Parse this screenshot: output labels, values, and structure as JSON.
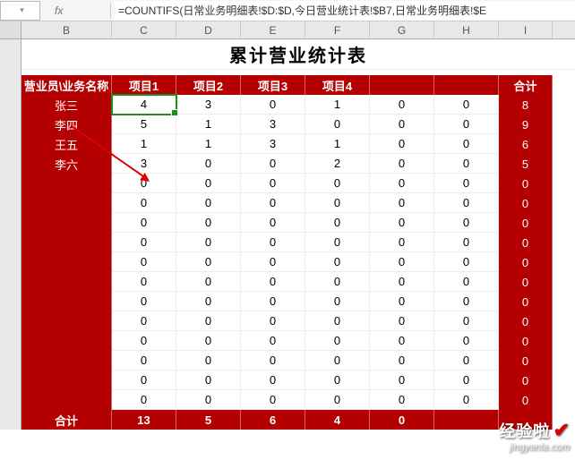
{
  "formula_bar": {
    "name_box": "",
    "fx": "fx",
    "formula": "=COUNTIFS(日常业务明细表!$D:$D,今日营业统计表!$B7,日常业务明细表!$E"
  },
  "col_headers": [
    "B",
    "C",
    "D",
    "E",
    "F",
    "G",
    "H",
    "I"
  ],
  "title": "累计营业统计表",
  "table_headers": {
    "name_col": "营业员\\业务名称",
    "items": [
      "项目1",
      "项目2",
      "项目3",
      "项目4"
    ],
    "total": "合计"
  },
  "rows": [
    {
      "name": "张三",
      "values": [
        4,
        3,
        0,
        1,
        0,
        0
      ],
      "total": 8
    },
    {
      "name": "李四",
      "values": [
        5,
        1,
        3,
        0,
        0,
        0
      ],
      "total": 9
    },
    {
      "name": "王五",
      "values": [
        1,
        1,
        3,
        1,
        0,
        0
      ],
      "total": 6
    },
    {
      "name": "李六",
      "values": [
        3,
        0,
        0,
        2,
        0,
        0
      ],
      "total": 5
    },
    {
      "name": "",
      "values": [
        0,
        0,
        0,
        0,
        0,
        0
      ],
      "total": 0
    },
    {
      "name": "",
      "values": [
        0,
        0,
        0,
        0,
        0,
        0
      ],
      "total": 0
    },
    {
      "name": "",
      "values": [
        0,
        0,
        0,
        0,
        0,
        0
      ],
      "total": 0
    },
    {
      "name": "",
      "values": [
        0,
        0,
        0,
        0,
        0,
        0
      ],
      "total": 0
    },
    {
      "name": "",
      "values": [
        0,
        0,
        0,
        0,
        0,
        0
      ],
      "total": 0
    },
    {
      "name": "",
      "values": [
        0,
        0,
        0,
        0,
        0,
        0
      ],
      "total": 0
    },
    {
      "name": "",
      "values": [
        0,
        0,
        0,
        0,
        0,
        0
      ],
      "total": 0
    },
    {
      "name": "",
      "values": [
        0,
        0,
        0,
        0,
        0,
        0
      ],
      "total": 0
    },
    {
      "name": "",
      "values": [
        0,
        0,
        0,
        0,
        0,
        0
      ],
      "total": 0
    },
    {
      "name": "",
      "values": [
        0,
        0,
        0,
        0,
        0,
        0
      ],
      "total": 0
    },
    {
      "name": "",
      "values": [
        0,
        0,
        0,
        0,
        0,
        0
      ],
      "total": 0
    },
    {
      "name": "",
      "values": [
        0,
        0,
        0,
        0,
        0,
        0
      ],
      "total": 0
    }
  ],
  "totals_row": {
    "label": "合计",
    "values": [
      13,
      5,
      6,
      4,
      0,
      ""
    ],
    "total": ""
  },
  "selected_cell": {
    "row": 0,
    "col": 0
  },
  "watermark": {
    "line1": "经验啦",
    "line2": "jingyanla.com"
  },
  "chart_data": {
    "type": "table",
    "title": "累计营业统计表",
    "row_header_label": "营业员\\业务名称",
    "columns": [
      "项目1",
      "项目2",
      "项目3",
      "项目4",
      "",
      "",
      "合计"
    ],
    "rows": [
      {
        "label": "张三",
        "cells": [
          4,
          3,
          0,
          1,
          0,
          0,
          8
        ]
      },
      {
        "label": "李四",
        "cells": [
          5,
          1,
          3,
          0,
          0,
          0,
          9
        ]
      },
      {
        "label": "王五",
        "cells": [
          1,
          1,
          3,
          1,
          0,
          0,
          6
        ]
      },
      {
        "label": "李六",
        "cells": [
          3,
          0,
          0,
          2,
          0,
          0,
          5
        ]
      },
      {
        "label": "",
        "cells": [
          0,
          0,
          0,
          0,
          0,
          0,
          0
        ]
      },
      {
        "label": "",
        "cells": [
          0,
          0,
          0,
          0,
          0,
          0,
          0
        ]
      },
      {
        "label": "",
        "cells": [
          0,
          0,
          0,
          0,
          0,
          0,
          0
        ]
      },
      {
        "label": "",
        "cells": [
          0,
          0,
          0,
          0,
          0,
          0,
          0
        ]
      },
      {
        "label": "",
        "cells": [
          0,
          0,
          0,
          0,
          0,
          0,
          0
        ]
      },
      {
        "label": "",
        "cells": [
          0,
          0,
          0,
          0,
          0,
          0,
          0
        ]
      },
      {
        "label": "",
        "cells": [
          0,
          0,
          0,
          0,
          0,
          0,
          0
        ]
      },
      {
        "label": "",
        "cells": [
          0,
          0,
          0,
          0,
          0,
          0,
          0
        ]
      },
      {
        "label": "",
        "cells": [
          0,
          0,
          0,
          0,
          0,
          0,
          0
        ]
      },
      {
        "label": "",
        "cells": [
          0,
          0,
          0,
          0,
          0,
          0,
          0
        ]
      },
      {
        "label": "",
        "cells": [
          0,
          0,
          0,
          0,
          0,
          0,
          0
        ]
      },
      {
        "label": "",
        "cells": [
          0,
          0,
          0,
          0,
          0,
          0,
          0
        ]
      }
    ],
    "totals": {
      "label": "合计",
      "cells": [
        13,
        5,
        6,
        4,
        0,
        "",
        ""
      ]
    }
  }
}
